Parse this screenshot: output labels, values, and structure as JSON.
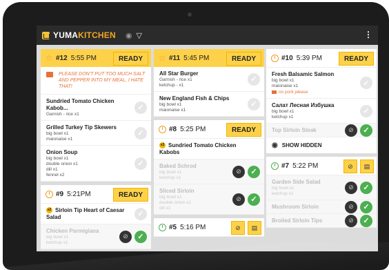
{
  "app": {
    "brand_a": "YUMA",
    "brand_b": "KITCHEN",
    "menu": "⋮"
  },
  "ready_label": "READY",
  "show_hidden": "SHOW HIDDEN",
  "orders": {
    "o12": {
      "num": "#12",
      "time": "5:55 PM",
      "note": "PLEASE DON'T PUT TOO MUCH SALT AND PEPPER INTO MY MEAL, I HATE THAT!",
      "items": [
        {
          "name": "Sundried Tomato Chicken Kabob...",
          "sub": [
            "Garnish - rice x1"
          ]
        },
        {
          "name": "Grilled Turkey Tip Skewers",
          "sub": [
            "big bowl x1",
            "maionaise x1"
          ]
        },
        {
          "name": "Onion Soup",
          "sub": [
            "big bowl  x1",
            "double onion  x1",
            "dill  x1",
            "fennel  x2"
          ]
        }
      ]
    },
    "o9": {
      "num": "#9",
      "time": "5:21PM",
      "items": [
        {
          "qty": "x2",
          "name": "Sirloin Tip Heart of Caesar Salad",
          "sub": []
        },
        {
          "name": "Chicken Parmigiana",
          "sub": [
            "big bowl x1",
            "ketchup x1"
          ]
        }
      ]
    },
    "o11": {
      "num": "#11",
      "time": "5:45 PM",
      "items": [
        {
          "name": "All Star Burger",
          "sub": [
            "Garnish - rice x1",
            "ketchup - x1"
          ]
        },
        {
          "name": "New England Fish & Chips",
          "sub": [
            "big bowl x1",
            "maionaise x1"
          ]
        }
      ]
    },
    "o8": {
      "num": "#8",
      "time": "5:25 PM",
      "items": [
        {
          "qty": "x3",
          "name": "Sundried Tomato Chicken Kabobs",
          "sub": []
        },
        {
          "name": "Baked Schrod",
          "sub": [
            "big bowl x1",
            "ketchup x1"
          ]
        },
        {
          "name": "Sliced Sirloin",
          "sub": [
            "big bowl  x1",
            "double onion  x1",
            "dill  x1"
          ]
        }
      ]
    },
    "o5": {
      "num": "#5",
      "time": "5:16 PM"
    },
    "o10": {
      "num": "#10",
      "time": "5:39 PM",
      "items": [
        {
          "name": "Fresh Balsamic Salmon",
          "sub": [
            "big bowl x1",
            "maionaise x1"
          ],
          "note": "no pork please"
        },
        {
          "name": "Салат Лесная Избушка",
          "sub": [
            "big bowl x1",
            "ketchup x1"
          ]
        },
        {
          "name": "Top Sirloin Steak",
          "sub": []
        }
      ]
    },
    "o7": {
      "num": "#7",
      "time": "5:22 PM",
      "items": [
        {
          "name": "Garden Side Salad",
          "sub": [
            "big bowl x1",
            "ketchup x1"
          ]
        },
        {
          "name": "Mushroom Sirloin",
          "sub": []
        },
        {
          "name": "Broiled Sirloin Tips",
          "sub": []
        }
      ]
    }
  },
  "colors": {
    "accent_yellow": "#fdd24a",
    "orange": "#f39a1d",
    "green": "#4caf50",
    "note": "#e8703a",
    "dark": "#2b2b2b"
  },
  "icons": {
    "star": "star-icon",
    "clock": "clock-icon",
    "eye": "eye-icon",
    "filter": "filter-icon",
    "check": "check-icon",
    "printer": "printer-icon",
    "hide": "hide-icon"
  }
}
